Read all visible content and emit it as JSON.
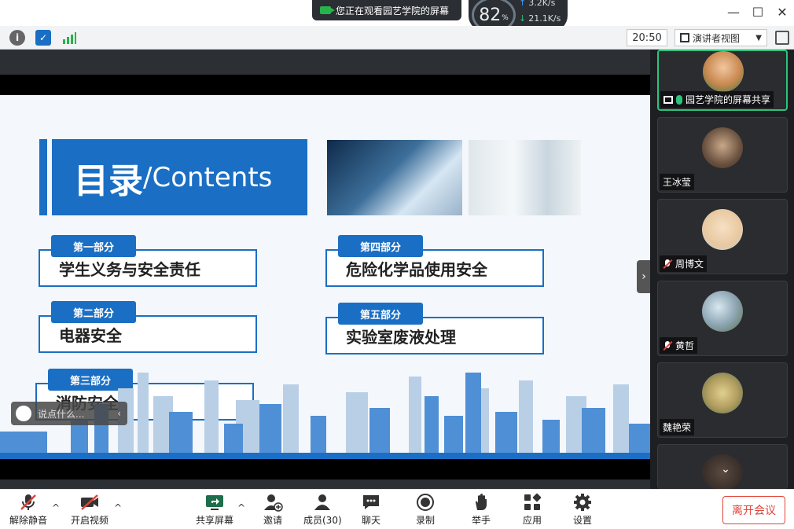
{
  "titlebar": {
    "share_banner": "您正在观看园艺学院的屏幕",
    "net_percent": "82",
    "net_percent_unit": "%",
    "upload_rate": "3.2K/s",
    "download_rate": "21.1K/s",
    "minimize": "—",
    "maximize": "☐",
    "close": "✕"
  },
  "toolbar": {
    "timer": "20:50",
    "view_mode": "演讲者视图"
  },
  "slide": {
    "title_cn": "目录",
    "title_en": "/Contents",
    "sections": [
      {
        "label": "第一部分",
        "text": "学生义务与安全责任"
      },
      {
        "label": "第二部分",
        "text": "电器安全"
      },
      {
        "label": "第三部分",
        "text": "消防安全"
      },
      {
        "label": "第四部分",
        "text": "危险化学品使用安全"
      },
      {
        "label": "第五部分",
        "text": "实验室废液处理"
      }
    ]
  },
  "chat": {
    "placeholder": "说点什么..."
  },
  "participants": [
    {
      "name": "园艺学院的屏幕共享",
      "muted": false,
      "sharing": true
    },
    {
      "name": "王冰莹",
      "muted": false
    },
    {
      "name": "周博文",
      "muted": true
    },
    {
      "name": "黄哲",
      "muted": true
    },
    {
      "name": "魏艳荣",
      "muted": false
    }
  ],
  "bottombar": {
    "unmute": "解除静音",
    "start_video": "开启视频",
    "share_screen": "共享屏幕",
    "invite": "邀请",
    "members": "成员(30)",
    "chat": "聊天",
    "record": "录制",
    "raise_hand": "举手",
    "apps": "应用",
    "settings": "设置",
    "leave": "离开会议"
  },
  "colors": {
    "accent": "#1a6fc4",
    "leave": "#e0443a",
    "active_border": "#2cc37a"
  }
}
